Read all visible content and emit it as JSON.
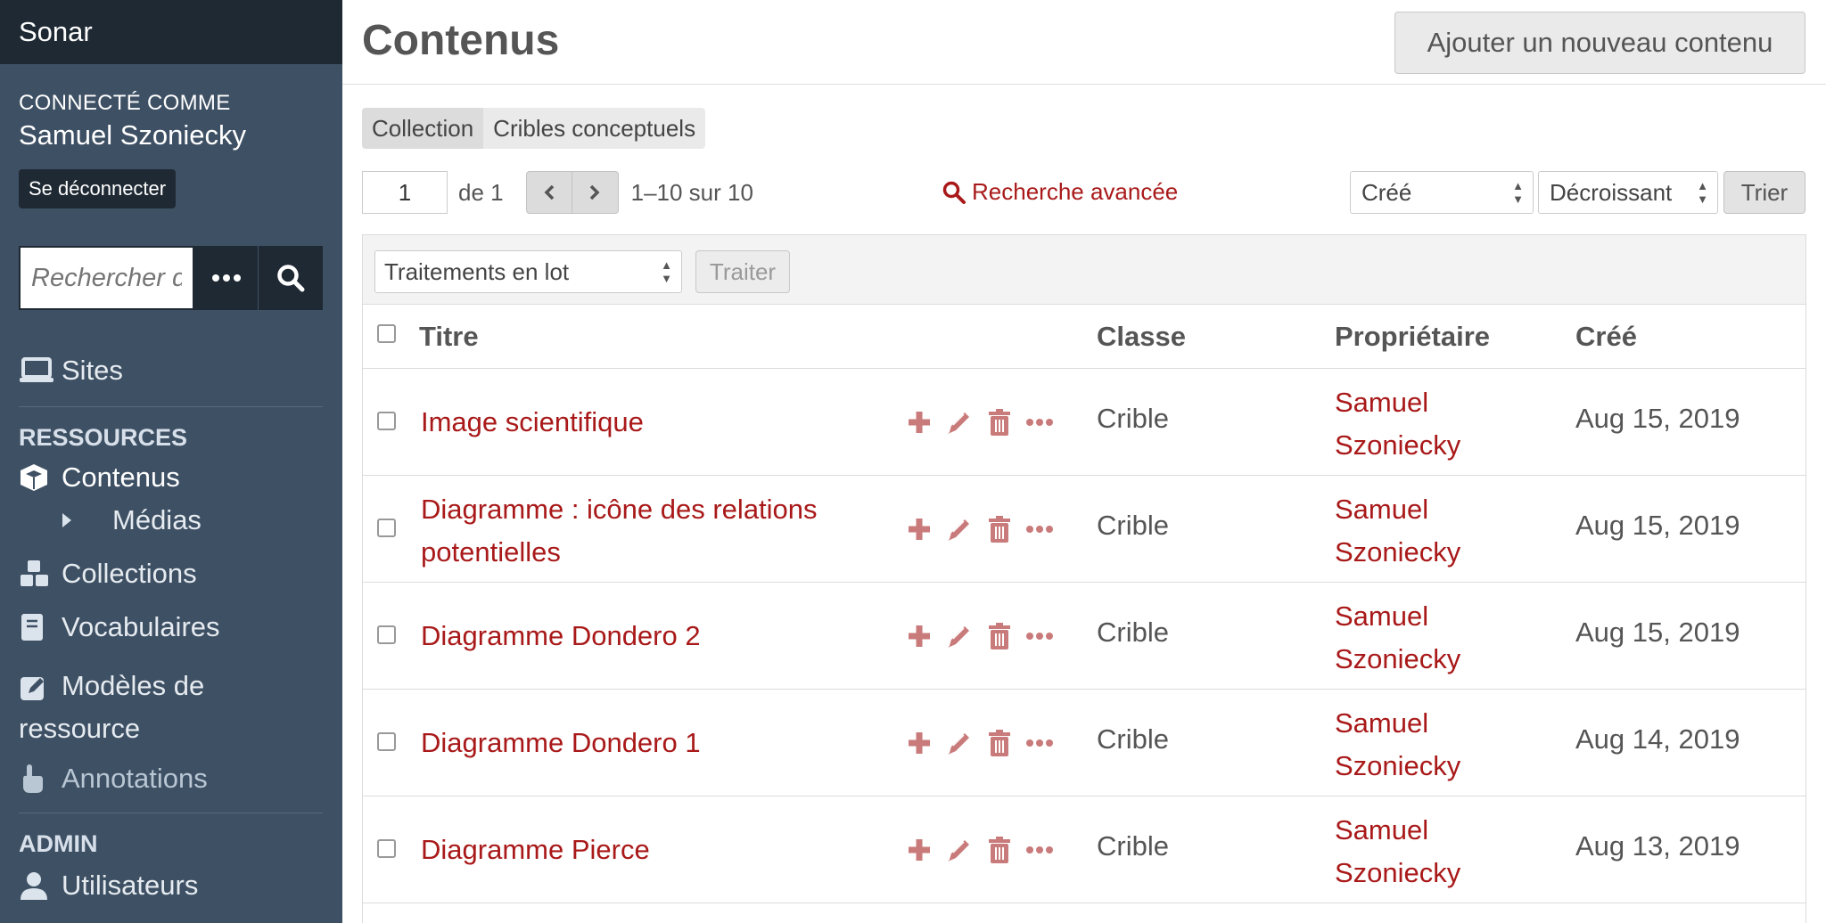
{
  "app": {
    "brand": "Sonar"
  },
  "sidebar": {
    "logged_label": "Connecté comme",
    "user_name": "Samuel Szoniecky",
    "logout_label": "Se déconnecter",
    "search": {
      "placeholder": "Rechercher d"
    },
    "sites_label": "Sites",
    "resources_heading": "Ressources",
    "items_label": "Contenus",
    "media_label": "Médias",
    "collections_label": "Collections",
    "vocabularies_label": "Vocabulaires",
    "templates_label": "Modèles de ressource",
    "annotations_label": "Annotations",
    "admin_heading": "Admin",
    "users_label": "Utilisateurs"
  },
  "header": {
    "title": "Contenus",
    "add_label": "Ajouter un nouveau contenu"
  },
  "subnav": {
    "tabs": [
      "Collection",
      "Cribles conceptuels"
    ]
  },
  "pagination": {
    "page": "1",
    "of_label": "de 1",
    "range_label": "1–10 sur 10"
  },
  "advanced_search_label": "Recherche avancée",
  "sort": {
    "field": "Créé",
    "order": "Décroissant",
    "button_label": "Trier"
  },
  "batch": {
    "select_label": "Traitements en lot",
    "button_label": "Traiter"
  },
  "table": {
    "columns": [
      "Titre",
      "Classe",
      "Propriétaire",
      "Créé"
    ],
    "rows": [
      {
        "title": "Image scientifique",
        "classe": "Crible",
        "owner": "Samuel Szoniecky",
        "created": "Aug 15, 2019"
      },
      {
        "title": "Diagramme : icône des relations potentielles",
        "classe": "Crible",
        "owner": "Samuel Szoniecky",
        "created": "Aug 15, 2019"
      },
      {
        "title": "Diagramme Dondero 2",
        "classe": "Crible",
        "owner": "Samuel Szoniecky",
        "created": "Aug 15, 2019"
      },
      {
        "title": "Diagramme Dondero 1",
        "classe": "Crible",
        "owner": "Samuel Szoniecky",
        "created": "Aug 14, 2019"
      },
      {
        "title": "Diagramme Pierce",
        "classe": "Crible",
        "owner": "Samuel Szoniecky",
        "created": "Aug 13, 2019"
      }
    ]
  },
  "colors": {
    "link": "#a91919",
    "sidebar": "#3e5064",
    "sidebar_dark": "#1f2933",
    "action_icon": "#c97a7a"
  }
}
